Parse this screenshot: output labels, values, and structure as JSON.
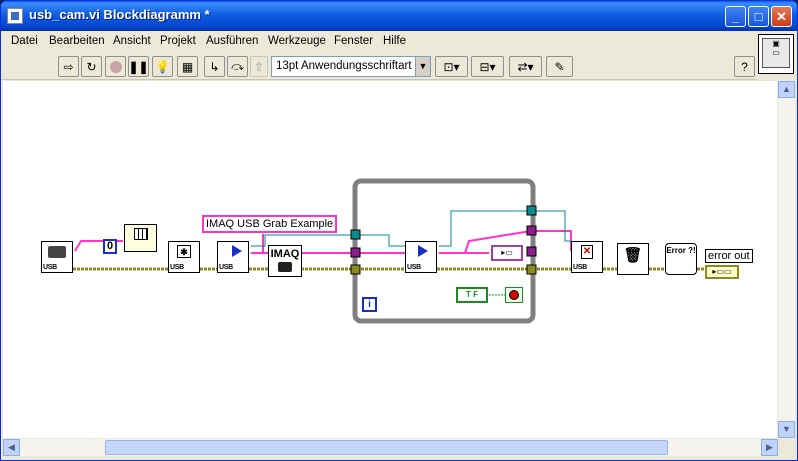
{
  "window": {
    "title": "usb_cam.vi Blockdiagramm *",
    "minimize": "_",
    "maximize": "□",
    "close": "✕"
  },
  "menu": [
    "Datei",
    "Bearbeiten",
    "Ansicht",
    "Projekt",
    "Ausführen",
    "Werkzeuge",
    "Fenster",
    "Hilfe"
  ],
  "toolbar": {
    "font": "13pt Anwendungsschriftart",
    "help": "?"
  },
  "diagram": {
    "constant_value": "0",
    "string_constant": "IMAQ USB Grab Example",
    "imaq_label": "IMAQ",
    "loop_iteration": "i",
    "tf_label": "T F",
    "error_label": "Error ?!",
    "error_out_label": "error out",
    "usb_tag": "USB"
  },
  "colors": {
    "wire_error": "#8a8a1e",
    "wire_string": "#ff33cc",
    "wire_image": "#0a8a8a",
    "wire_bool": "#00aa00",
    "loop_frame": "#808080"
  }
}
